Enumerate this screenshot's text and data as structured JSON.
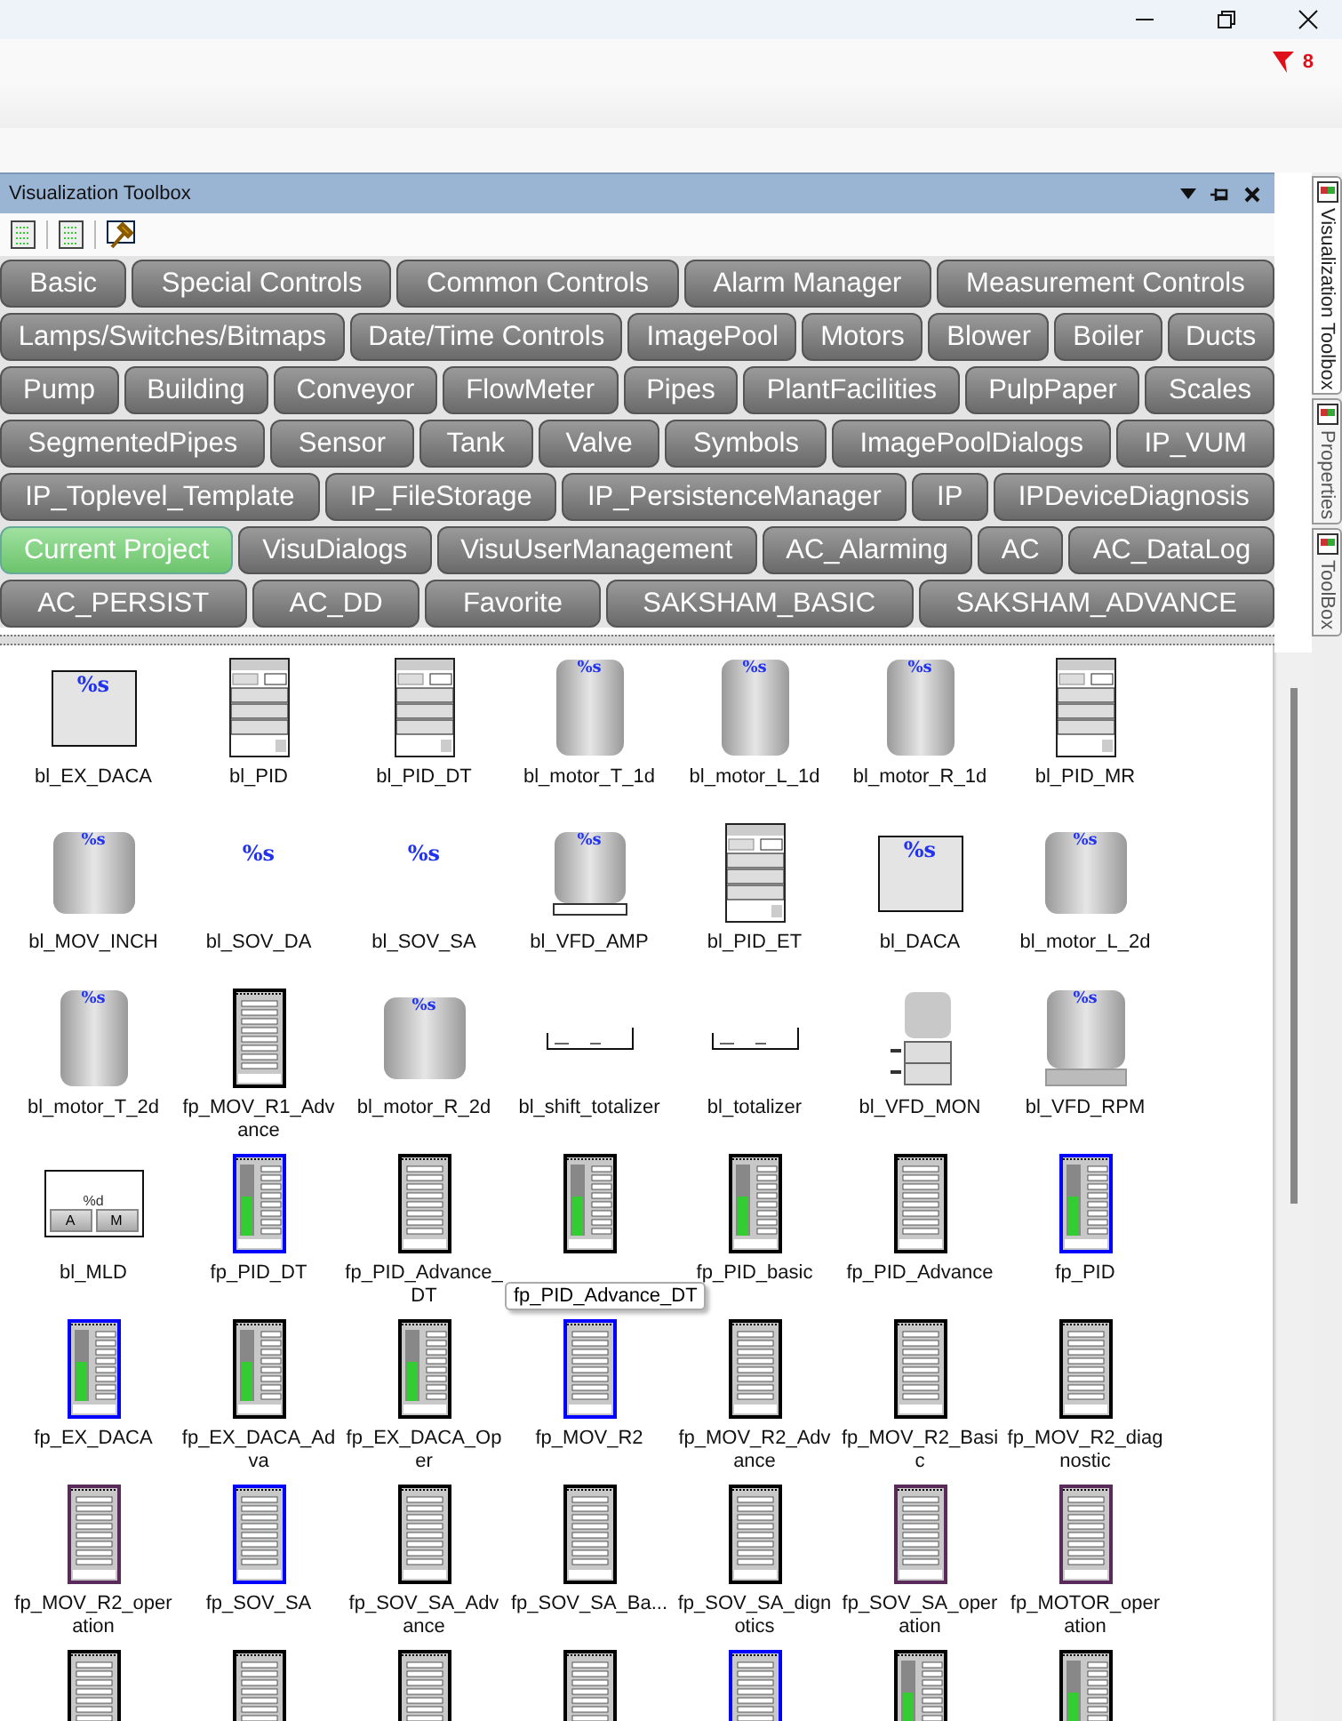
{
  "notification": {
    "count": "8"
  },
  "panel": {
    "title": "Visualization Toolbox"
  },
  "side_tabs": [
    {
      "label": "Visualization Toolbox",
      "selected": true
    },
    {
      "label": "Properties",
      "selected": false
    },
    {
      "label": "ToolBox",
      "selected": false
    }
  ],
  "category_rows": [
    [
      {
        "label": "Basic",
        "selected": false
      },
      {
        "label": "Special Controls",
        "selected": false
      },
      {
        "label": "Common Controls",
        "selected": false
      },
      {
        "label": "Alarm Manager",
        "selected": false
      },
      {
        "label": "Measurement Controls",
        "selected": false
      }
    ],
    [
      {
        "label": "Lamps/Switches/Bitmaps",
        "selected": false
      },
      {
        "label": "Date/Time Controls",
        "selected": false
      },
      {
        "label": "ImagePool",
        "selected": false
      },
      {
        "label": "Motors",
        "selected": false
      },
      {
        "label": "Blower",
        "selected": false
      },
      {
        "label": "Boiler",
        "selected": false
      },
      {
        "label": "Ducts",
        "selected": false
      }
    ],
    [
      {
        "label": "Pump",
        "selected": false
      },
      {
        "label": "Building",
        "selected": false
      },
      {
        "label": "Conveyor",
        "selected": false
      },
      {
        "label": "FlowMeter",
        "selected": false
      },
      {
        "label": "Pipes",
        "selected": false
      },
      {
        "label": "PlantFacilities",
        "selected": false
      },
      {
        "label": "PulpPaper",
        "selected": false
      },
      {
        "label": "Scales",
        "selected": false
      }
    ],
    [
      {
        "label": "SegmentedPipes",
        "selected": false
      },
      {
        "label": "Sensor",
        "selected": false
      },
      {
        "label": "Tank",
        "selected": false
      },
      {
        "label": "Valve",
        "selected": false
      },
      {
        "label": "Symbols",
        "selected": false
      },
      {
        "label": "ImagePoolDialogs",
        "selected": false
      },
      {
        "label": "IP_VUM",
        "selected": false
      }
    ],
    [
      {
        "label": "IP_Toplevel_Template",
        "selected": false
      },
      {
        "label": "IP_FileStorage",
        "selected": false
      },
      {
        "label": "IP_PersistenceManager",
        "selected": false
      },
      {
        "label": "IP",
        "selected": false
      },
      {
        "label": "IPDeviceDiagnosis",
        "selected": false
      }
    ],
    [
      {
        "label": "Current Project",
        "selected": true
      },
      {
        "label": "VisuDialogs",
        "selected": false
      },
      {
        "label": "VisuUserManagement",
        "selected": false
      },
      {
        "label": "AC_Alarming",
        "selected": false
      },
      {
        "label": "AC",
        "selected": false
      },
      {
        "label": "AC_DataLog",
        "selected": false
      }
    ],
    [
      {
        "label": "AC_PERSIST",
        "selected": false
      },
      {
        "label": "AC_DD",
        "selected": false
      },
      {
        "label": "Favorite",
        "selected": false
      },
      {
        "label": "SAKSHAM_BASIC",
        "selected": false
      },
      {
        "label": "SAKSHAM_ADVANCE",
        "selected": false
      }
    ]
  ],
  "items": [
    {
      "label": "bl_EX_DACA",
      "kind": "box",
      "caption": "%s"
    },
    {
      "label": "bl_PID",
      "kind": "pid"
    },
    {
      "label": "bl_PID_DT",
      "kind": "pid"
    },
    {
      "label": "bl_motor_T_1d",
      "kind": "motor",
      "caption": "%s"
    },
    {
      "label": "bl_motor_L_1d",
      "kind": "motor",
      "caption": "%s"
    },
    {
      "label": "bl_motor_R_1d",
      "kind": "motor",
      "caption": "%s"
    },
    {
      "label": "bl_PID_MR",
      "kind": "pid"
    },
    {
      "label": "bl_MOV_INCH",
      "kind": "motor-wide",
      "caption": "%s"
    },
    {
      "label": "bl_SOV_DA",
      "kind": "text",
      "caption": "%s"
    },
    {
      "label": "bl_SOV_SA",
      "kind": "text",
      "caption": "%s"
    },
    {
      "label": "bl_VFD_AMP",
      "kind": "vfd",
      "caption": "%s"
    },
    {
      "label": "bl_PID_ET",
      "kind": "pid"
    },
    {
      "label": "bl_DACA",
      "kind": "box",
      "caption": "%s"
    },
    {
      "label": "bl_motor_L_2d",
      "kind": "motor-wide",
      "caption": "%s"
    },
    {
      "label": "bl_motor_T_2d",
      "kind": "motor",
      "caption": "%s"
    },
    {
      "label": "fp_MOV_R1_Advance",
      "kind": "faceplate",
      "color": "#000000",
      "bar": false
    },
    {
      "label": "bl_motor_R_2d",
      "kind": "motor-wide",
      "caption": "%s"
    },
    {
      "label": "bl_shift_totalizer",
      "kind": "totalizer"
    },
    {
      "label": "bl_totalizer",
      "kind": "totalizer"
    },
    {
      "label": "bl_VFD_MON",
      "kind": "vfd-mon"
    },
    {
      "label": "bl_VFD_RPM",
      "kind": "vfd-rpm",
      "caption": "%s"
    },
    {
      "label": "bl_MLD",
      "kind": "mld",
      "caption": "%d",
      "keys": [
        "A",
        "M"
      ]
    },
    {
      "label": "fp_PID_DT",
      "kind": "faceplate",
      "color": "#0000ff",
      "bar": true
    },
    {
      "label": "fp_PID_Advance_DT",
      "kind": "faceplate",
      "color": "#000000",
      "bar": false
    },
    {
      "kind": "faceplate",
      "color": "#000000",
      "bar": true
    },
    {
      "label": "fp_PID_basic",
      "kind": "faceplate",
      "color": "#000000",
      "bar": true
    },
    {
      "label": "fp_PID_Advance",
      "kind": "faceplate",
      "color": "#000000",
      "bar": false
    },
    {
      "label": "fp_PID",
      "kind": "faceplate",
      "color": "#0000ff",
      "bar": true
    },
    {
      "label": "fp_EX_DACA",
      "kind": "faceplate",
      "color": "#0000ff",
      "bar": true
    },
    {
      "label": "fp_EX_DACA_Adva",
      "kind": "faceplate",
      "color": "#000000",
      "bar": true
    },
    {
      "label": "fp_EX_DACA_Oper",
      "kind": "faceplate",
      "color": "#000000",
      "bar": true
    },
    {
      "label": "fp_MOV_R2",
      "kind": "faceplate",
      "color": "#0000ff",
      "bar": false
    },
    {
      "label": "fp_MOV_R2_Advance",
      "kind": "faceplate",
      "color": "#000000",
      "bar": false
    },
    {
      "label": "fp_MOV_R2_Basic",
      "kind": "faceplate",
      "color": "#000000",
      "bar": false
    },
    {
      "label": "fp_MOV_R2_diagnostic",
      "kind": "faceplate",
      "color": "#000000",
      "bar": false
    },
    {
      "label": "fp_MOV_R2_operation",
      "kind": "faceplate",
      "color": "#5a2a5a",
      "bar": false
    },
    {
      "label": "fp_SOV_SA",
      "kind": "faceplate",
      "color": "#0000ff",
      "bar": false
    },
    {
      "label": "fp_SOV_SA_Advance",
      "kind": "faceplate",
      "color": "#000000",
      "bar": false
    },
    {
      "label": "fp_SOV_SA_Ba...",
      "kind": "faceplate",
      "color": "#000000",
      "bar": false
    },
    {
      "label": "fp_SOV_SA_dignotics",
      "kind": "faceplate",
      "color": "#000000",
      "bar": false
    },
    {
      "label": "fp_SOV_SA_operation",
      "kind": "faceplate",
      "color": "#5a2a5a",
      "bar": false
    },
    {
      "label": "fp_MOTOR_operation",
      "kind": "faceplate",
      "color": "#5a2a5a",
      "bar": false
    },
    {
      "kind": "faceplate",
      "color": "#000000",
      "bar": false
    },
    {
      "kind": "faceplate",
      "color": "#000000",
      "bar": false
    },
    {
      "kind": "faceplate",
      "color": "#000000",
      "bar": false
    },
    {
      "kind": "faceplate",
      "color": "#000000",
      "bar": false
    },
    {
      "kind": "faceplate",
      "color": "#0000ff",
      "bar": false
    },
    {
      "kind": "faceplate",
      "color": "#000000",
      "bar": true
    },
    {
      "kind": "faceplate",
      "color": "#000000",
      "bar": true
    }
  ],
  "tooltip": {
    "text": "fp_PID_Advance_DT"
  }
}
